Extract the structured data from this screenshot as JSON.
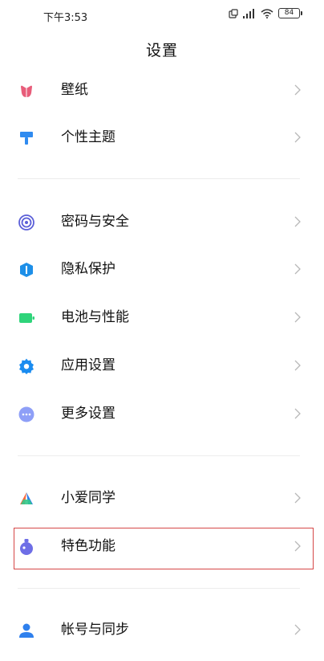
{
  "status_bar": {
    "time": "下午3:53",
    "battery": "84",
    "icons": [
      "sim-icon",
      "signal-icon",
      "wifi-icon",
      "battery-icon"
    ]
  },
  "header": {
    "title": "设置"
  },
  "items": [
    {
      "label": "壁纸",
      "icon": "wallpaper-icon",
      "color": "#e85d7a"
    },
    {
      "label": "个性主题",
      "icon": "theme-icon",
      "color": "#2f8bf0"
    },
    {
      "label": "密码与安全",
      "icon": "fingerprint-icon",
      "color": "#5b5fd8"
    },
    {
      "label": "隐私保护",
      "icon": "privacy-icon",
      "color": "#1d8fe8"
    },
    {
      "label": "电池与性能",
      "icon": "battery-performance-icon",
      "color": "#2ed47a"
    },
    {
      "label": "应用设置",
      "icon": "gear-icon",
      "color": "#1a8cf0"
    },
    {
      "label": "更多设置",
      "icon": "more-icon",
      "color": "#8e9ff7"
    },
    {
      "label": "小爱同学",
      "icon": "xiaoai-icon",
      "color": "#ff6a3d"
    },
    {
      "label": "特色功能",
      "icon": "special-features-icon",
      "color": "#6e6ee6"
    },
    {
      "label": "帐号与同步",
      "icon": "account-icon",
      "color": "#2f80ed"
    }
  ]
}
